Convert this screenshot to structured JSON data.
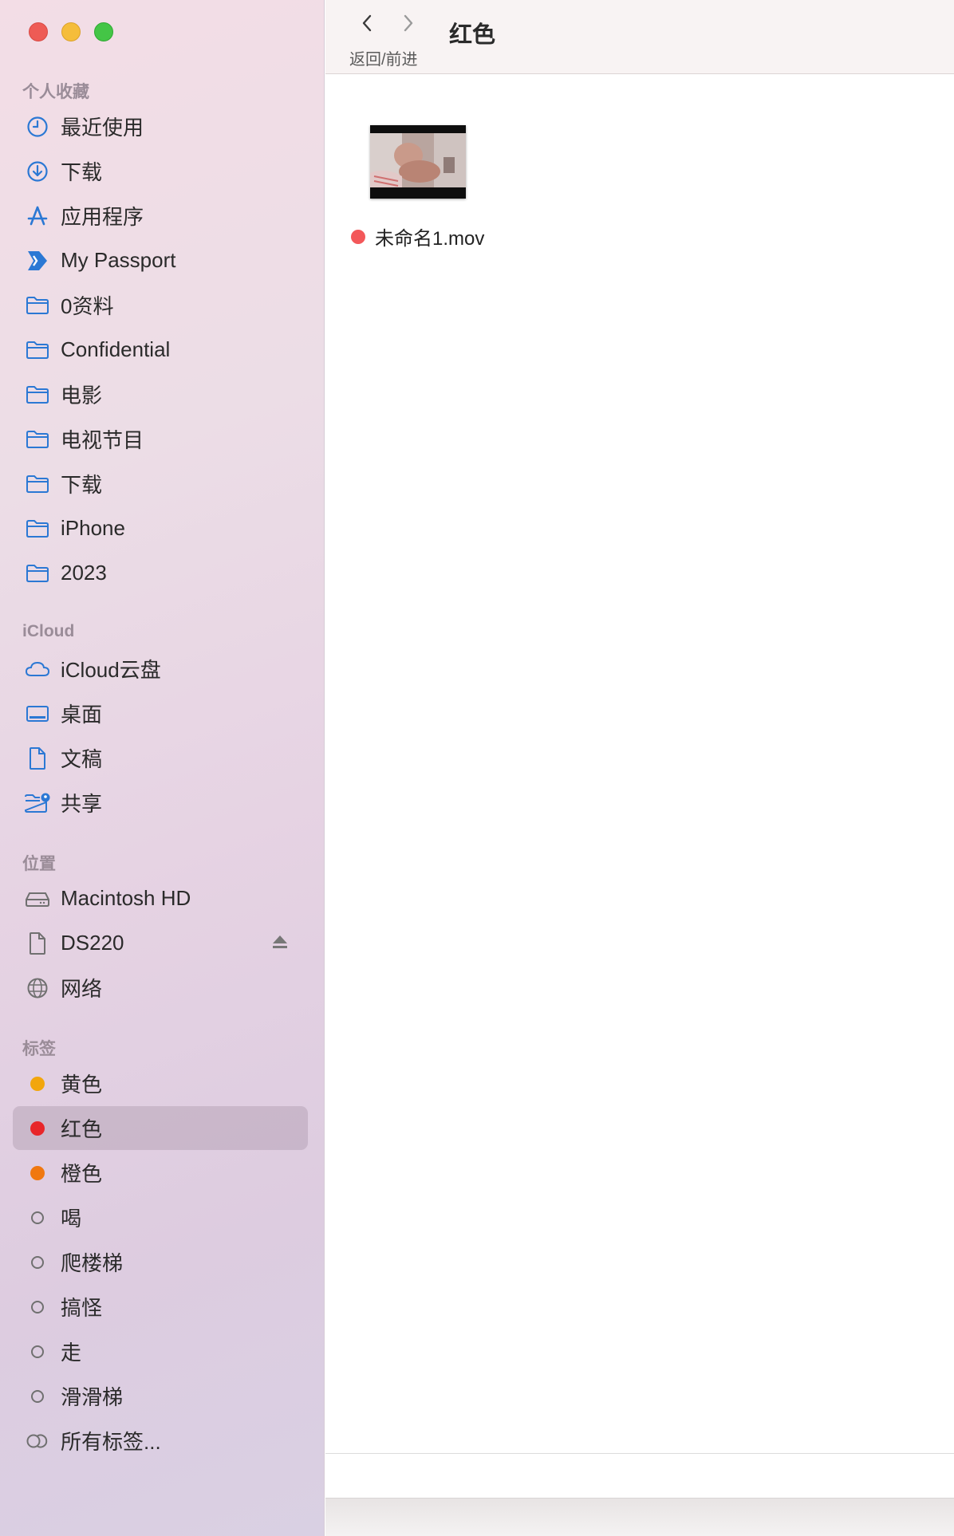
{
  "window": {
    "title": "红色",
    "nav_caption": "返回/前进"
  },
  "sidebar": {
    "favorites_title": "个人收藏",
    "favorites": [
      {
        "label": "最近使用",
        "icon": "clock-icon"
      },
      {
        "label": "下载",
        "icon": "download-icon"
      },
      {
        "label": "应用程序",
        "icon": "apps-icon"
      },
      {
        "label": "My Passport",
        "icon": "drive-icon"
      },
      {
        "label": "0资料",
        "icon": "folder-icon"
      },
      {
        "label": "Confidential",
        "icon": "folder-icon"
      },
      {
        "label": "电影",
        "icon": "folder-icon"
      },
      {
        "label": "电视节目",
        "icon": "folder-icon"
      },
      {
        "label": "下载",
        "icon": "folder-icon"
      },
      {
        "label": "iPhone",
        "icon": "folder-icon"
      },
      {
        "label": "2023",
        "icon": "folder-icon"
      }
    ],
    "icloud_title": "iCloud",
    "icloud": [
      {
        "label": "iCloud云盘",
        "icon": "cloud-icon"
      },
      {
        "label": "桌面",
        "icon": "desktop-icon"
      },
      {
        "label": "文稿",
        "icon": "document-icon"
      },
      {
        "label": "共享",
        "icon": "shared-folder-icon"
      }
    ],
    "locations_title": "位置",
    "locations": [
      {
        "label": "Macintosh HD",
        "icon": "hard-drive-icon"
      },
      {
        "label": "DS220",
        "icon": "document-icon"
      },
      {
        "label": "网络",
        "icon": "network-icon"
      }
    ],
    "tags_title": "标签",
    "tags": [
      {
        "label": "黄色",
        "color": "#f2a60d"
      },
      {
        "label": "红色",
        "color": "#e8262a"
      },
      {
        "label": "橙色",
        "color": "#f07810"
      },
      {
        "label": "喝",
        "color": ""
      },
      {
        "label": "爬楼梯",
        "color": ""
      },
      {
        "label": "搞怪",
        "color": ""
      },
      {
        "label": "走",
        "color": ""
      },
      {
        "label": "滑滑梯",
        "color": ""
      },
      {
        "label": "所有标签...",
        "color": ""
      }
    ]
  },
  "files": [
    {
      "name": "未命名1.mov",
      "tag_color": "#f3585a"
    }
  ],
  "colors": {
    "accent": "#2b78d4",
    "selected_bg": "#c9b6c8"
  }
}
